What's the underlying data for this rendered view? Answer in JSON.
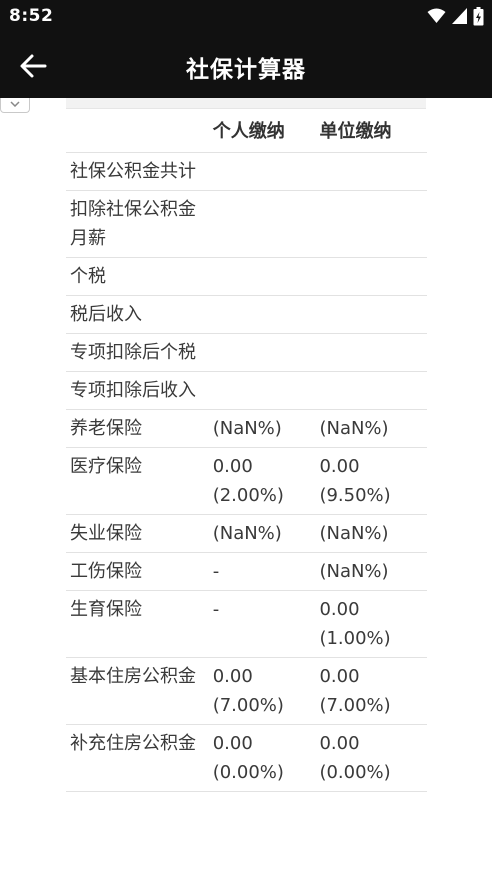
{
  "status_bar": {
    "time": "8:52",
    "icons": [
      "wifi-icon",
      "cellular-signal-icon",
      "battery-icon"
    ]
  },
  "app_bar": {
    "back_icon": "arrow-left-icon",
    "title": "社保计算器"
  },
  "collapse_toggle": {
    "icon": "chevron-down-icon"
  },
  "table": {
    "headers": {
      "label": "",
      "personal": "个人缴纳",
      "company": "单位缴纳"
    },
    "rows": [
      {
        "label": "社保公积金共计",
        "personal": [],
        "company": []
      },
      {
        "label": "扣除社保公积金月薪",
        "personal": [],
        "company": []
      },
      {
        "label": "个税",
        "personal": [],
        "company": []
      },
      {
        "label": "税后收入",
        "personal": [],
        "company": []
      },
      {
        "label": "专项扣除后个税",
        "personal": [],
        "company": []
      },
      {
        "label": "专项扣除后收入",
        "personal": [],
        "company": []
      },
      {
        "label": "养老保险",
        "personal": [
          "(NaN%)"
        ],
        "company": [
          "(NaN%)"
        ]
      },
      {
        "label": "医疗保险",
        "personal": [
          "0.00",
          "(2.00%)"
        ],
        "company": [
          "0.00",
          "(9.50%)"
        ]
      },
      {
        "label": "失业保险",
        "personal": [
          "(NaN%)"
        ],
        "company": [
          "(NaN%)"
        ]
      },
      {
        "label": "工伤保险",
        "personal": [
          "-"
        ],
        "company": [
          "(NaN%)"
        ]
      },
      {
        "label": "生育保险",
        "personal": [
          "-"
        ],
        "company": [
          "0.00",
          "(1.00%)"
        ]
      },
      {
        "label": "基本住房公积金",
        "personal": [
          "0.00",
          "(7.00%)"
        ],
        "company": [
          "0.00",
          "(7.00%)"
        ]
      },
      {
        "label": "补充住房公积金",
        "personal": [
          "0.00",
          "(0.00%)"
        ],
        "company": [
          "0.00",
          "(0.00%)"
        ]
      }
    ]
  }
}
